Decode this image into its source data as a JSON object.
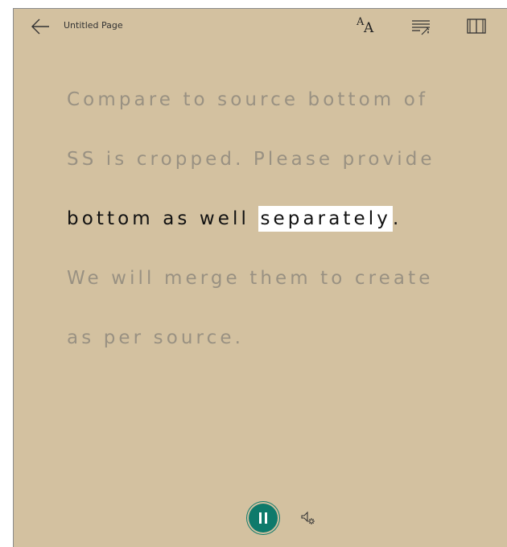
{
  "header": {
    "page_title": "Untitled Page",
    "text_size_glyph": "A"
  },
  "content": {
    "lines": [
      "Compare to source bottom of",
      "SS is cropped. Please provide",
      "We will merge them to create",
      "as per source."
    ],
    "current_line": {
      "before": "bottom as well ",
      "highlight": "separately",
      "after": "."
    }
  },
  "icons": {
    "back": "arrow-left-icon",
    "text_preferences": "text-size-icon",
    "grammar_options": "grammar-options-icon",
    "reading_preferences": "book-icon",
    "pause": "pause-icon",
    "voice_settings": "voice-settings-icon"
  },
  "colors": {
    "page_background": "#d3c1a0",
    "accent": "#0e7a6b",
    "highlight": "#ffffff"
  }
}
